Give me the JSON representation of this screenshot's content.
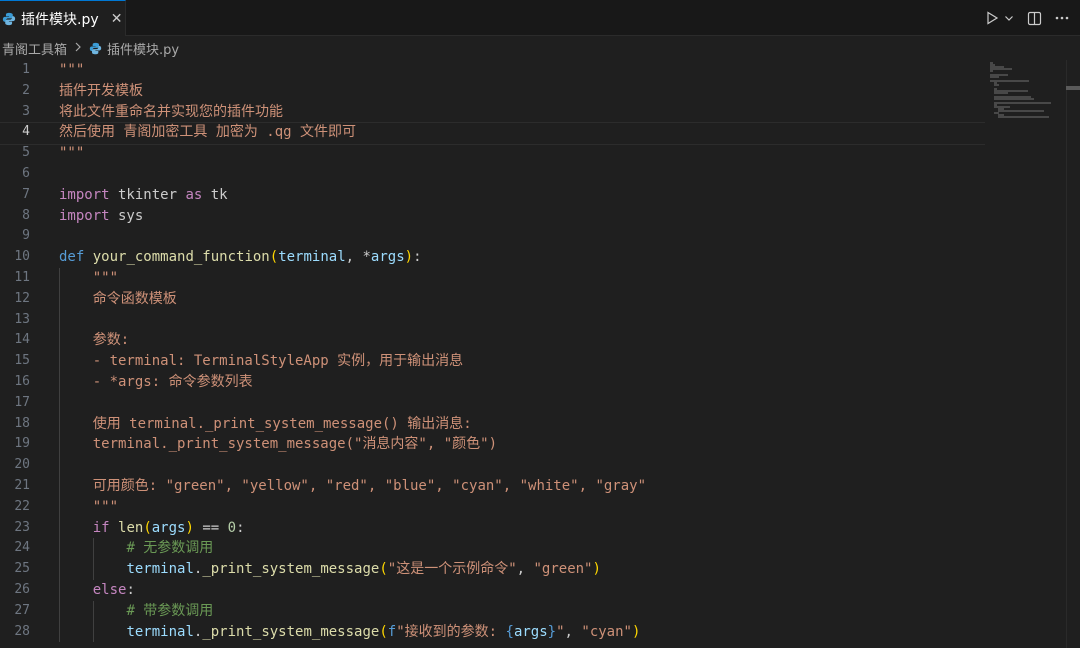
{
  "tab": {
    "label": "插件模块.py",
    "close_glyph": "✕"
  },
  "actions": {
    "run_glyph": "▷",
    "dropdown_glyph": "⌄",
    "split_glyph": "◫",
    "more_glyph": "···"
  },
  "breadcrumb": {
    "folder": "青阁工具箱",
    "file": "插件模块.py"
  },
  "editor": {
    "active_line": 4,
    "line_numbers": [
      "1",
      "2",
      "3",
      "4",
      "5",
      "6",
      "7",
      "8",
      "9",
      "10",
      "11",
      "12",
      "13",
      "14",
      "15",
      "16",
      "17",
      "18",
      "19",
      "20",
      "21",
      "22",
      "23",
      "24",
      "25",
      "26",
      "27",
      "28"
    ],
    "lines": [
      {
        "indent": 0,
        "tokens": [
          [
            "str",
            "\"\"\""
          ]
        ]
      },
      {
        "indent": 0,
        "tokens": [
          [
            "str",
            "插件开发模板"
          ]
        ]
      },
      {
        "indent": 0,
        "tokens": [
          [
            "str",
            "将此文件重命名并实现您的插件功能"
          ]
        ]
      },
      {
        "indent": 0,
        "tokens": [
          [
            "str",
            "然后使用 青阁加密工具 加密为 .qg 文件即可"
          ]
        ]
      },
      {
        "indent": 0,
        "tokens": [
          [
            "str",
            "\"\"\""
          ]
        ]
      },
      {
        "indent": 0,
        "tokens": []
      },
      {
        "indent": 0,
        "tokens": [
          [
            "kwc",
            "import"
          ],
          [
            "txt",
            " tkinter "
          ],
          [
            "kwc",
            "as"
          ],
          [
            "txt",
            " tk"
          ]
        ]
      },
      {
        "indent": 0,
        "tokens": [
          [
            "kwc",
            "import"
          ],
          [
            "txt",
            " sys"
          ]
        ]
      },
      {
        "indent": 0,
        "tokens": []
      },
      {
        "indent": 0,
        "tokens": [
          [
            "kw",
            "def"
          ],
          [
            "txt",
            " "
          ],
          [
            "fn",
            "your_command_function"
          ],
          [
            "brk",
            "("
          ],
          [
            "par",
            "terminal"
          ],
          [
            "txt",
            ", *"
          ],
          [
            "par",
            "args"
          ],
          [
            "brk",
            ")"
          ],
          [
            "txt",
            ":"
          ]
        ]
      },
      {
        "indent": 1,
        "tokens": [
          [
            "str",
            "\"\"\""
          ]
        ]
      },
      {
        "indent": 1,
        "tokens": [
          [
            "str",
            "命令函数模板"
          ]
        ]
      },
      {
        "indent": 1,
        "tokens": []
      },
      {
        "indent": 1,
        "tokens": [
          [
            "str",
            "参数:"
          ]
        ]
      },
      {
        "indent": 1,
        "tokens": [
          [
            "str",
            "- terminal: TerminalStyleApp 实例，用于输出消息"
          ]
        ]
      },
      {
        "indent": 1,
        "tokens": [
          [
            "str",
            "- *args: 命令参数列表"
          ]
        ]
      },
      {
        "indent": 1,
        "tokens": []
      },
      {
        "indent": 1,
        "tokens": [
          [
            "str",
            "使用 terminal._print_system_message() 输出消息:"
          ]
        ]
      },
      {
        "indent": 1,
        "tokens": [
          [
            "str",
            "terminal._print_system_message(\"消息内容\", \"颜色\")"
          ]
        ]
      },
      {
        "indent": 1,
        "tokens": []
      },
      {
        "indent": 1,
        "tokens": [
          [
            "str",
            "可用颜色: \"green\", \"yellow\", \"red\", \"blue\", \"cyan\", \"white\", \"gray\""
          ]
        ]
      },
      {
        "indent": 1,
        "tokens": [
          [
            "str",
            "\"\"\""
          ]
        ]
      },
      {
        "indent": 1,
        "tokens": [
          [
            "kwc",
            "if"
          ],
          [
            "txt",
            " "
          ],
          [
            "fn",
            "len"
          ],
          [
            "brk",
            "("
          ],
          [
            "par",
            "args"
          ],
          [
            "brk",
            ")"
          ],
          [
            "txt",
            " == "
          ],
          [
            "num",
            "0"
          ],
          [
            "txt",
            ":"
          ]
        ]
      },
      {
        "indent": 2,
        "tokens": [
          [
            "cmt",
            "# 无参数调用"
          ]
        ]
      },
      {
        "indent": 2,
        "tokens": [
          [
            "par",
            "terminal"
          ],
          [
            "txt",
            "."
          ],
          [
            "fn",
            "_print_system_message"
          ],
          [
            "brk",
            "("
          ],
          [
            "str",
            "\"这是一个示例命令\""
          ],
          [
            "txt",
            ", "
          ],
          [
            "str",
            "\"green\""
          ],
          [
            "brk",
            ")"
          ]
        ]
      },
      {
        "indent": 1,
        "tokens": [
          [
            "kwc",
            "else"
          ],
          [
            "txt",
            ":"
          ]
        ]
      },
      {
        "indent": 2,
        "tokens": [
          [
            "cmt",
            "# 带参数调用"
          ]
        ]
      },
      {
        "indent": 2,
        "tokens": [
          [
            "par",
            "terminal"
          ],
          [
            "txt",
            "."
          ],
          [
            "fn",
            "_print_system_message"
          ],
          [
            "brk",
            "("
          ],
          [
            "fstr",
            "f"
          ],
          [
            "str",
            "\"接收到的参数: "
          ],
          [
            "fstr",
            "{"
          ],
          [
            "par",
            "args"
          ],
          [
            "fstr",
            "}"
          ],
          [
            "str",
            "\""
          ],
          [
            "txt",
            ", "
          ],
          [
            "str",
            "\"cyan\""
          ],
          [
            "brk",
            ")"
          ]
        ]
      }
    ]
  }
}
